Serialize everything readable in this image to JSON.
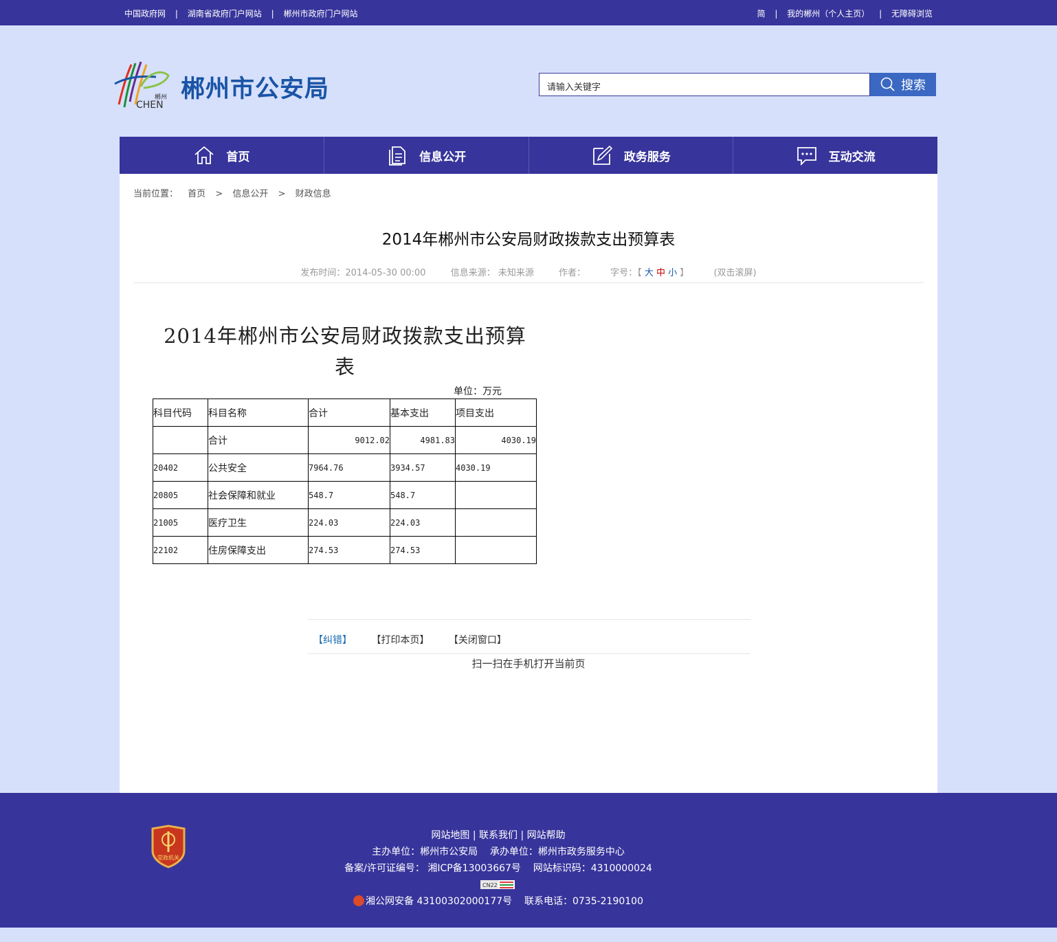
{
  "topbar": {
    "left_links": [
      "中国政府网",
      "湖南省政府门户网站",
      "郴州市政府门户网站"
    ],
    "right_links": [
      "简",
      "我的郴州（个人主页）",
      "无障碍浏览"
    ],
    "separator": "|"
  },
  "header": {
    "logo_small_text": "郴州",
    "logo_latin": "CHEN",
    "site_title": "郴州市公安局",
    "search_placeholder": "请输入关键字",
    "search_button": "搜索"
  },
  "nav": {
    "items": [
      {
        "label": "首页",
        "icon": "home-icon"
      },
      {
        "label": "信息公开",
        "icon": "document-icon"
      },
      {
        "label": "政务服务",
        "icon": "edit-icon"
      },
      {
        "label": "互动交流",
        "icon": "chat-icon"
      }
    ]
  },
  "breadcrumb": {
    "prefix": "当前位置：",
    "items": [
      "首页",
      "信息公开",
      "财政信息"
    ],
    "separator": ">"
  },
  "article": {
    "title": "2014年郴州市公安局财政拨款支出预算表",
    "meta": {
      "publish_time": "发布时间：2014-05-30 00:00",
      "source_label": "信息来源：",
      "source_value": "未知来源",
      "author_label": "作者：",
      "font_label": "字号：",
      "bracket_open": "【",
      "font_large": "大",
      "font_medium": "中",
      "font_small": "小",
      "bracket_close": "】",
      "scroll_hint": "(双击滚屏)"
    },
    "doc_title_line1": "2014年郴州市公安局财政拨款支出预算",
    "doc_title_line2": "表",
    "unit": "单位：万元",
    "table": {
      "headers": [
        "科目代码",
        "科目名称",
        "合计",
        "基本支出",
        "项目支出"
      ],
      "total_row": [
        "",
        "合计",
        "9012.02",
        "4981.83",
        "4030.19"
      ],
      "rows": [
        [
          "20402",
          "公共安全",
          "7964.76",
          "3934.57",
          "4030.19"
        ],
        [
          "20805",
          "社会保障和就业",
          "548.7",
          "548.7",
          ""
        ],
        [
          "21005",
          "医疗卫生",
          "224.03",
          "224.03",
          ""
        ],
        [
          "22102",
          "住房保障支出",
          "274.53",
          "274.53",
          ""
        ]
      ]
    },
    "tools": [
      "【纠错】",
      "【打印本页】",
      "【关闭窗口】"
    ],
    "scan_text": "扫一扫在手机打开当前页"
  },
  "footer": {
    "emblem_text": "党政机关",
    "links": [
      "网站地图",
      "联系我们",
      "网站帮助"
    ],
    "sponsor": "主办单位：郴州市公安局",
    "organizer": "承办单位：郴州市政务服务中心",
    "icp": "备案/许可证编号： 湘ICP备13003667号",
    "site_id": "网站标识码：4310000024",
    "badge_text": "CN22",
    "police_record": "湘公网安备 43100302000177号",
    "phone": "联系电话：0735-2190100"
  },
  "colors": {
    "primary": "#37349b",
    "background": "#d6e0fb",
    "title_blue": "#1a54a6",
    "search_button": "#3a68c2"
  }
}
